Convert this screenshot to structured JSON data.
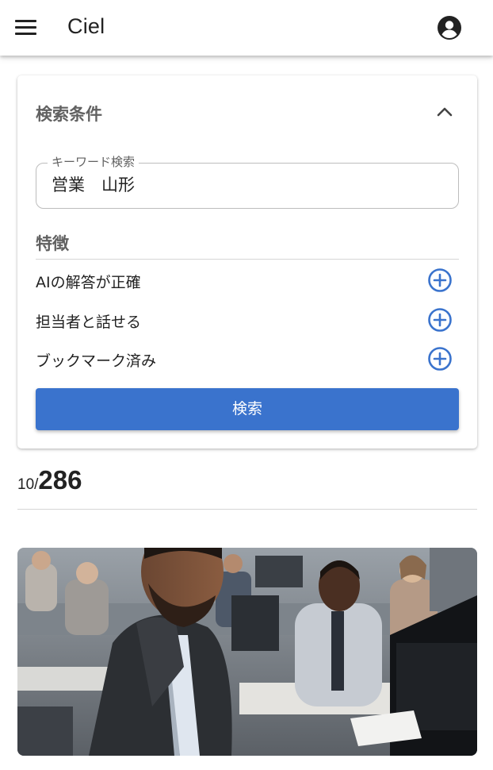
{
  "app": {
    "title": "Ciel",
    "menu_icon": "menu-icon",
    "account_icon": "account-circle-icon"
  },
  "search": {
    "title": "検索条件",
    "collapse_icon": "chevron-up-icon",
    "keyword": {
      "label": "キーワード検索",
      "value": "営業　山形"
    },
    "features": {
      "title": "特徴",
      "items": [
        {
          "label": "AIの解答が正確",
          "icon": "add-circle-icon"
        },
        {
          "label": "担当者と話せる",
          "icon": "add-circle-icon"
        },
        {
          "label": "ブックマーク済み",
          "icon": "add-circle-icon"
        }
      ]
    },
    "button_label": "検索"
  },
  "results": {
    "shown": "10",
    "separator": "/",
    "total": "286"
  },
  "colors": {
    "accent": "#3a73cd",
    "heading": "#616161",
    "text": "#222222"
  }
}
